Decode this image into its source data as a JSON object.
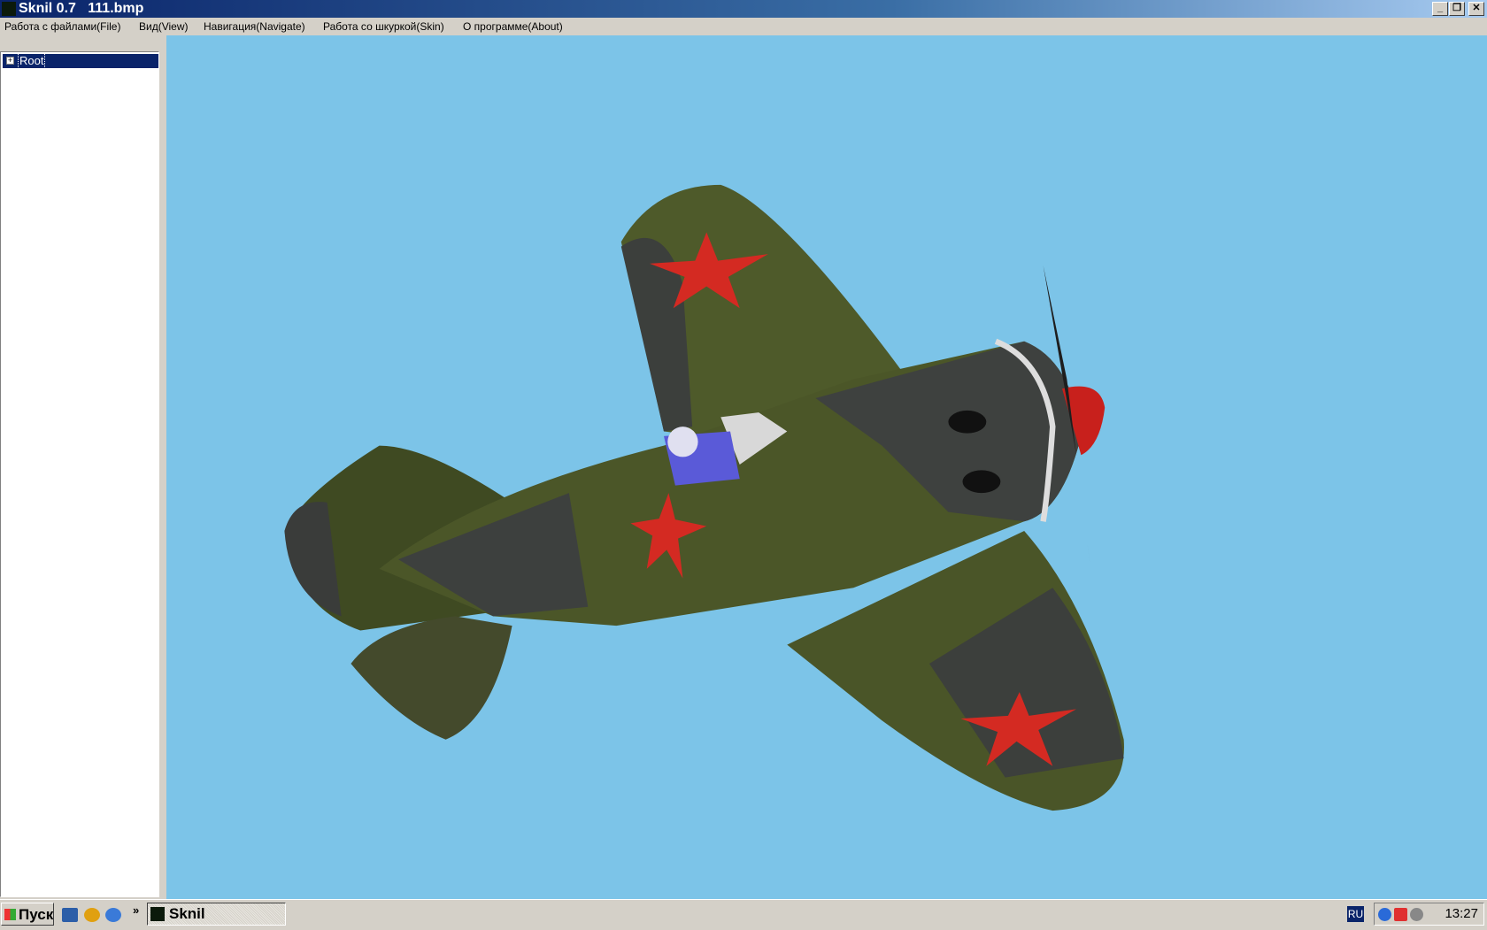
{
  "window": {
    "title": "Sknil 0.7   111.bmp",
    "buttons": {
      "minimize": "_",
      "maximize": "❐",
      "close": "✕"
    }
  },
  "menu": [
    "Работа с файлами(File)",
    "Вид(View)",
    "Навигация(Navigate)",
    "Работа со шкуркой(Skin)",
    "О программе(About)"
  ],
  "tree": {
    "root": "Root",
    "expander": "+"
  },
  "viewport": {
    "background": "#7cc4e8"
  },
  "taskbar": {
    "start": "Пуск",
    "chevron": "»",
    "task": "Sknil",
    "language": "RU",
    "clock": "13:27"
  }
}
